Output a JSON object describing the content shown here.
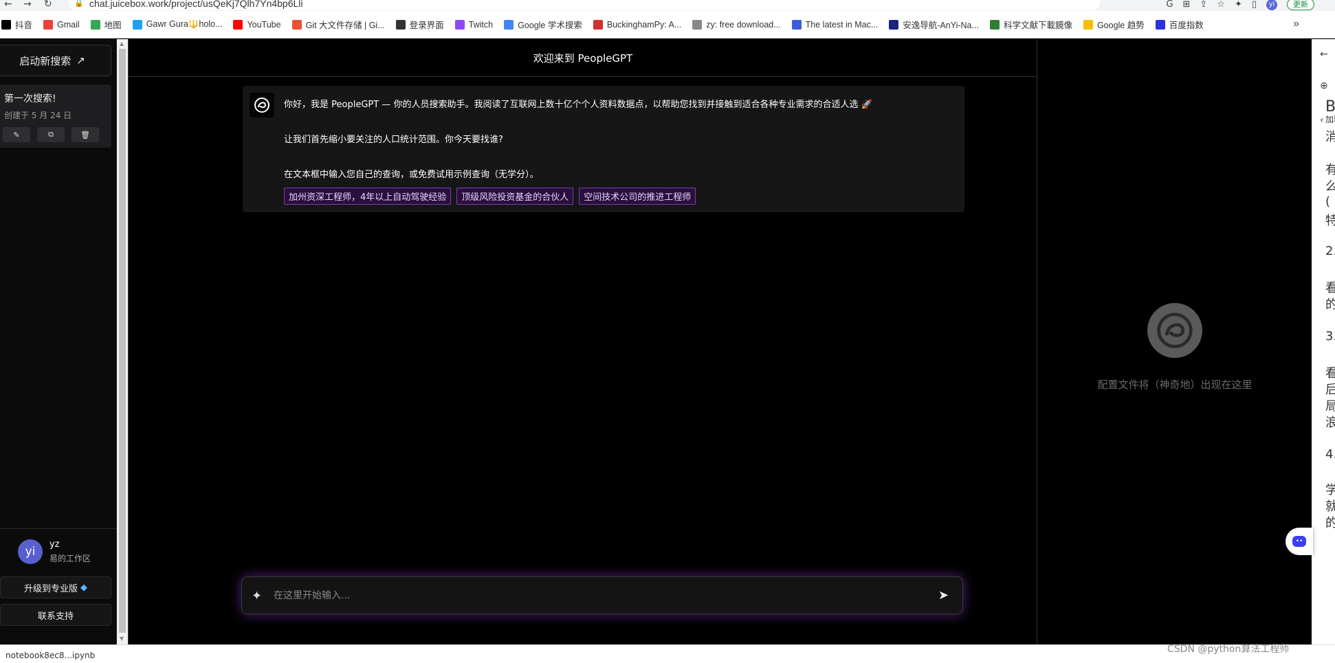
{
  "browser": {
    "url": "chat.juicebox.work/project/usQeKj7Qlh7Yn4bp6Lli",
    "update_label": "更新",
    "profile_initial": "yi"
  },
  "bookmarks": [
    {
      "label": "抖音",
      "icon": "tiktok-icon",
      "color": "#000000"
    },
    {
      "label": "Gmail",
      "icon": "gmail-icon",
      "color": "#ea4335"
    },
    {
      "label": "地图",
      "icon": "maps-icon",
      "color": "#34a853"
    },
    {
      "label": "Gawr Gura🔱holo...",
      "icon": "twitter-icon",
      "color": "#1da1f2"
    },
    {
      "label": "YouTube",
      "icon": "youtube-icon",
      "color": "#ff0000"
    },
    {
      "label": "Git 大文件存储 | Gi...",
      "icon": "git-icon",
      "color": "#f05033"
    },
    {
      "label": "登录界面",
      "icon": "globe-icon",
      "color": "#333333"
    },
    {
      "label": "Twitch",
      "icon": "twitch-icon",
      "color": "#9146ff"
    },
    {
      "label": "Google 学术搜索",
      "icon": "scholar-icon",
      "color": "#4285f4"
    },
    {
      "label": "BuckinghamPy: A...",
      "icon": "y-icon",
      "color": "#d32f2f"
    },
    {
      "label": "zy: free download...",
      "icon": "y-small-icon",
      "color": "#888888"
    },
    {
      "label": "The latest in Mac...",
      "icon": "mac-icon",
      "color": "#3b5bdb"
    },
    {
      "label": "安逸导航-AnYi-Na...",
      "icon": "anyi-icon",
      "color": "#1a237e"
    },
    {
      "label": "科学文献下載鏡像",
      "icon": "sci-icon",
      "color": "#2e7d32"
    },
    {
      "label": "Google 趋势",
      "icon": "trends-icon",
      "color": "#fbbc05"
    },
    {
      "label": "百度指数",
      "icon": "baidu-icon",
      "color": "#2932e1"
    }
  ],
  "sidebar": {
    "new_search_label": "启动新搜索",
    "chat": {
      "title": "第一次搜索!",
      "date": "创建于 5 月 24 日"
    },
    "user": {
      "initials": "yi",
      "name": "yz",
      "workspace": "易的工作区"
    },
    "upgrade_label": "升级到专业版",
    "support_label": "联系支持"
  },
  "main": {
    "header_title": "欢迎来到 PeopleGPT",
    "message": {
      "line1": "你好，我是 PeopleGPT — 你的人员搜索助手。我阅读了互联网上数十亿个个人资料数据点，以帮助您找到并接触到适合各种专业需求的合适人选 🚀",
      "line2": "让我们首先缩小要关注的人口统计范围。你今天要找谁?",
      "line3": "在文本框中输入您自己的查询，或免费试用示例查询（无学分）。",
      "chips": [
        "加州资深工程师，4年以上自动驾驶经验",
        "顶级风险投资基金的合伙人",
        "空间技术公司的推进工程师"
      ]
    },
    "input_placeholder": "在这里开始输入..."
  },
  "profile_panel": {
    "hint": "配置文件将（神奇地）出现在这里"
  },
  "side_panel_text": [
    "B",
    "加释",
    "消",
    "有",
    "么",
    "(",
    "特",
    "2.",
    "看",
    "的",
    "3.",
    "看",
    "后",
    "局",
    "浪",
    "4.",
    "学",
    "就",
    "的"
  ],
  "watermark": "CSDN @python算法工程师",
  "bottom_file": "notebook8ec8...ipynb"
}
